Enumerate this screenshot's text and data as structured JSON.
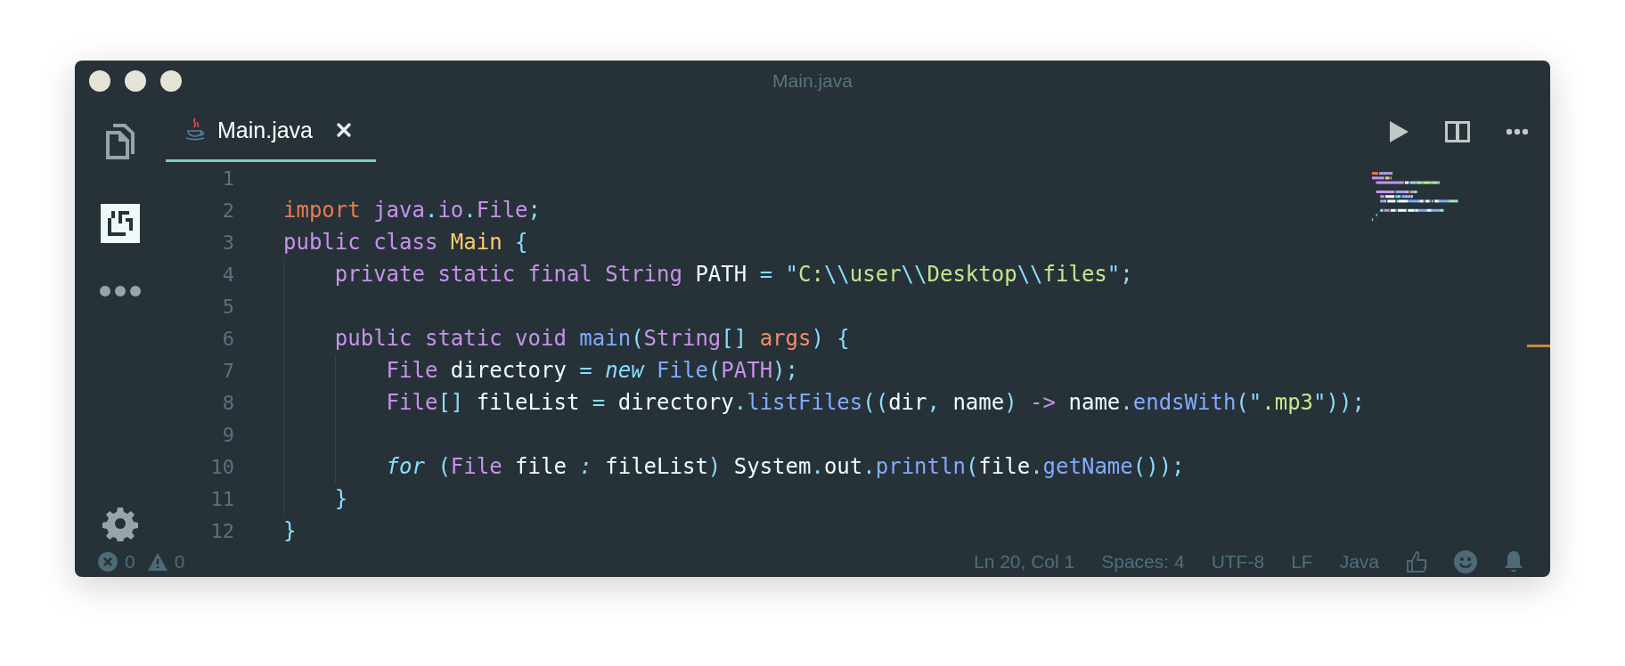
{
  "window": {
    "title": "Main.java"
  },
  "activity_bar": [
    {
      "kind": "files",
      "selected": false
    },
    {
      "kind": "extensions",
      "selected": true
    },
    {
      "kind": "more",
      "selected": false
    },
    {
      "kind": "settings",
      "selected": false
    }
  ],
  "tabs": [
    {
      "label": "Main.java",
      "selected": true
    }
  ],
  "editor": {
    "lines": [
      {
        "number": "1"
      },
      {
        "number": "2",
        "tokens": [
          {
            "text": "import",
            "kind": "import"
          },
          {
            "text": " java",
            "kind": "keyword"
          },
          {
            "text": ".",
            "kind": "punct"
          },
          {
            "text": "io",
            "kind": "keyword"
          },
          {
            "text": ".",
            "kind": "punct"
          },
          {
            "text": "File",
            "kind": "keyword"
          },
          {
            "text": ";",
            "kind": "punct"
          }
        ]
      },
      {
        "number": "3",
        "tokens": [
          {
            "text": "public class",
            "kind": "keyword"
          },
          {
            "text": " Main",
            "kind": "type"
          },
          {
            "text": " {",
            "kind": "punct"
          }
        ]
      },
      {
        "number": "4",
        "tokens": [
          {
            "text": "    private static final String",
            "kind": "keyword"
          },
          {
            "text": " PATH",
            "kind": "plain"
          },
          {
            "text": " = \"",
            "kind": "punct"
          },
          {
            "text": "C:",
            "kind": "string"
          },
          {
            "text": "\\\\",
            "kind": "punct"
          },
          {
            "text": "user",
            "kind": "string"
          },
          {
            "text": "\\\\",
            "kind": "punct"
          },
          {
            "text": "Desktop",
            "kind": "string"
          },
          {
            "text": "\\\\",
            "kind": "punct"
          },
          {
            "text": "files",
            "kind": "string"
          },
          {
            "text": "\";",
            "kind": "punct"
          }
        ]
      },
      {
        "number": "5"
      },
      {
        "number": "6",
        "tokens": [
          {
            "text": "    public static void",
            "kind": "keyword"
          },
          {
            "text": " main",
            "kind": "func"
          },
          {
            "text": "(",
            "kind": "punct"
          },
          {
            "text": "String",
            "kind": "keyword"
          },
          {
            "text": "[]",
            "kind": "punct"
          },
          {
            "text": " args",
            "kind": "param"
          },
          {
            "text": ") {",
            "kind": "punct"
          }
        ]
      },
      {
        "number": "7",
        "tokens": [
          {
            "text": "        File",
            "kind": "keyword"
          },
          {
            "text": " directory",
            "kind": "plain"
          },
          {
            "text": " = ",
            "kind": "punct"
          },
          {
            "text": "new",
            "kind": "italic"
          },
          {
            "text": " File",
            "kind": "func"
          },
          {
            "text": "(",
            "kind": "punct"
          },
          {
            "text": "PATH",
            "kind": "keyword"
          },
          {
            "text": ");",
            "kind": "punct"
          }
        ]
      },
      {
        "number": "8",
        "tokens": [
          {
            "text": "        File",
            "kind": "keyword"
          },
          {
            "text": "[]",
            "kind": "punct"
          },
          {
            "text": " fileList",
            "kind": "plain"
          },
          {
            "text": " = ",
            "kind": "punct"
          },
          {
            "text": "directory",
            "kind": "plain"
          },
          {
            "text": ".",
            "kind": "punct"
          },
          {
            "text": "listFiles",
            "kind": "func"
          },
          {
            "text": "((",
            "kind": "punct"
          },
          {
            "text": "dir",
            "kind": "plain"
          },
          {
            "text": ",",
            "kind": "punct"
          },
          {
            "text": " name",
            "kind": "plain"
          },
          {
            "text": ")",
            "kind": "punct"
          },
          {
            "text": " ->",
            "kind": "keyword"
          },
          {
            "text": " name",
            "kind": "plain"
          },
          {
            "text": ".",
            "kind": "punct"
          },
          {
            "text": "endsWith",
            "kind": "func"
          },
          {
            "text": "(\"",
            "kind": "punct"
          },
          {
            "text": ".mp3",
            "kind": "string"
          },
          {
            "text": "\"));",
            "kind": "punct"
          }
        ]
      },
      {
        "number": "9"
      },
      {
        "number": "10",
        "tokens": [
          {
            "text": "        for",
            "kind": "italic"
          },
          {
            "text": " (",
            "kind": "punct"
          },
          {
            "text": "File",
            "kind": "keyword"
          },
          {
            "text": " file ",
            "kind": "plain"
          },
          {
            "text": ":",
            "kind": "italic"
          },
          {
            "text": " fileList",
            "kind": "plain"
          },
          {
            "text": ")",
            "kind": "punct"
          },
          {
            "text": " System",
            "kind": "plain"
          },
          {
            "text": ".",
            "kind": "punct"
          },
          {
            "text": "out",
            "kind": "plain"
          },
          {
            "text": ".",
            "kind": "punct"
          },
          {
            "text": "println",
            "kind": "func"
          },
          {
            "text": "(",
            "kind": "punct"
          },
          {
            "text": "file",
            "kind": "plain"
          },
          {
            "text": ".",
            "kind": "punct"
          },
          {
            "text": "getName",
            "kind": "func"
          },
          {
            "text": "());",
            "kind": "punct"
          }
        ]
      },
      {
        "number": "11",
        "tokens": [
          {
            "text": "    }",
            "kind": "punct"
          }
        ]
      },
      {
        "number": "12",
        "tokens": [
          {
            "text": "}",
            "kind": "punct"
          }
        ]
      }
    ]
  },
  "status_bar": {
    "errors": "0",
    "warnings": "0",
    "items": [
      {
        "text": "Ln 20, Col 1"
      },
      {
        "text": "Spaces: 4"
      },
      {
        "text": "UTF-8"
      },
      {
        "text": "LF"
      },
      {
        "text": "Java"
      }
    ]
  }
}
